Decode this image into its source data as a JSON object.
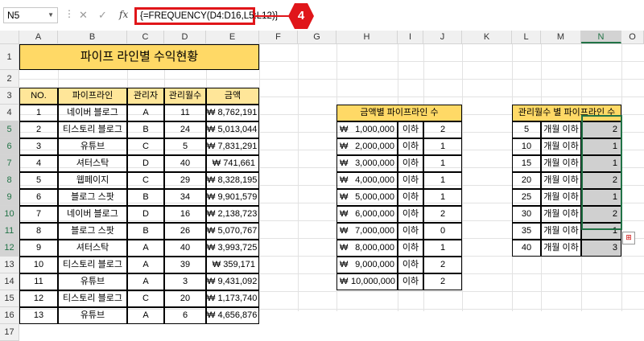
{
  "formula_bar": {
    "name_box": "N5",
    "formula": "{=FREQUENCY(D4:D16,L5:L12)}",
    "cancel_icon": "✕",
    "enter_icon": "✓",
    "fx": "fx"
  },
  "callout_number": "4",
  "columns": [
    "A",
    "B",
    "C",
    "D",
    "E",
    "F",
    "G",
    "H",
    "I",
    "J",
    "K",
    "L",
    "M",
    "N",
    "O"
  ],
  "rows": [
    "1",
    "2",
    "3",
    "4",
    "5",
    "6",
    "7",
    "8",
    "9",
    "10",
    "11",
    "12",
    "13",
    "14",
    "15",
    "16",
    "17"
  ],
  "main_table": {
    "title": "파이프 라인별 수익현황",
    "headers": [
      "NO.",
      "파이프라인",
      "관리자",
      "관리월수",
      "금액"
    ],
    "rows": [
      [
        "1",
        "네이버 블로그",
        "A",
        "11",
        "₩ 8,762,191"
      ],
      [
        "2",
        "티스토리 블로그",
        "B",
        "24",
        "₩ 5,013,044"
      ],
      [
        "3",
        "유튜브",
        "C",
        "5",
        "₩ 7,831,291"
      ],
      [
        "4",
        "셔터스탁",
        "D",
        "40",
        "₩ 741,661"
      ],
      [
        "5",
        "웹페이지",
        "C",
        "29",
        "₩ 8,328,195"
      ],
      [
        "6",
        "블로그 스팟",
        "B",
        "34",
        "₩ 9,901,579"
      ],
      [
        "7",
        "네이버 블로그",
        "D",
        "16",
        "₩ 2,138,723"
      ],
      [
        "8",
        "블로그 스팟",
        "B",
        "26",
        "₩ 5,070,767"
      ],
      [
        "9",
        "셔터스탁",
        "A",
        "40",
        "₩ 3,993,725"
      ],
      [
        "10",
        "티스토리 블로그",
        "A",
        "39",
        "₩ 359,171"
      ],
      [
        "11",
        "유튜브",
        "A",
        "3",
        "₩ 9,431,092"
      ],
      [
        "12",
        "티스토리 블로그",
        "C",
        "20",
        "₩ 1,173,740"
      ],
      [
        "13",
        "유튜브",
        "A",
        "6",
        "₩ 4,656,876"
      ]
    ]
  },
  "amount_table": {
    "title": "금액별 파이프라인 수",
    "rows": [
      [
        "₩",
        "1,000,000",
        "이하",
        "2"
      ],
      [
        "₩",
        "2,000,000",
        "이하",
        "1"
      ],
      [
        "₩",
        "3,000,000",
        "이하",
        "1"
      ],
      [
        "₩",
        "4,000,000",
        "이하",
        "1"
      ],
      [
        "₩",
        "5,000,000",
        "이하",
        "1"
      ],
      [
        "₩",
        "6,000,000",
        "이하",
        "2"
      ],
      [
        "₩",
        "7,000,000",
        "이하",
        "0"
      ],
      [
        "₩",
        "8,000,000",
        "이하",
        "1"
      ],
      [
        "₩",
        "9,000,000",
        "이하",
        "2"
      ],
      [
        "₩",
        "10,000,000",
        "이하",
        "2"
      ]
    ]
  },
  "months_table": {
    "title": "관리월수 별 파이프라인 수",
    "rows": [
      [
        "5",
        "개월 이하",
        "2"
      ],
      [
        "10",
        "개월 이하",
        "1"
      ],
      [
        "15",
        "개월 이하",
        "1"
      ],
      [
        "20",
        "개월 이하",
        "2"
      ],
      [
        "25",
        "개월 이하",
        "1"
      ],
      [
        "30",
        "개월 이하",
        "2"
      ],
      [
        "35",
        "개월 이하",
        "1"
      ],
      [
        "40",
        "개월 이하",
        "3"
      ]
    ]
  },
  "colors": {
    "title_fill": "#ffd966",
    "header_fill": "#ffe699",
    "selection": "#217346",
    "callout": "#e0161a"
  }
}
